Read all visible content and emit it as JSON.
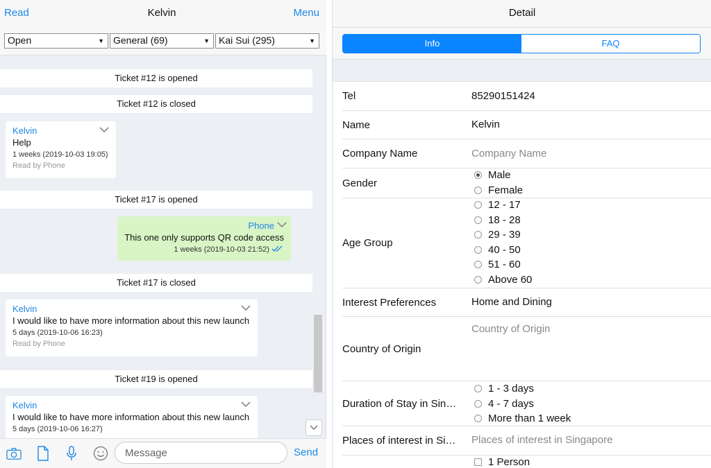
{
  "left_header": {
    "read": "Read",
    "title": "Kelvin",
    "menu": "Menu"
  },
  "filters": [
    {
      "value": "Open"
    },
    {
      "value": "General (69)"
    },
    {
      "value": "Kai Sui (295)"
    }
  ],
  "messages": {
    "sys1": "Ticket #12 is opened",
    "sys2": "Ticket #12 is closed",
    "m1": {
      "who": "Kelvin",
      "text": "Help",
      "time": "1 weeks (2019-10-03 19:05)",
      "readby": "Read by Phone"
    },
    "sys3": "Ticket #17 is opened",
    "m2": {
      "who": "Phone",
      "text": "This one only supports QR code access",
      "time": "1 weeks (2019-10-03 21:52)"
    },
    "sys4": "Ticket #17 is closed",
    "m3": {
      "who": "Kelvin",
      "text": "I would like to have more information about this new launch",
      "time": "5 days (2019-10-06 16:23)",
      "readby": "Read by Phone"
    },
    "sys5": "Ticket #19 is opened",
    "m4": {
      "who": "Kelvin",
      "text": "I would like to have more information about this new launch",
      "time": "5 days (2019-10-06 16:27)"
    }
  },
  "composer": {
    "placeholder": "Message",
    "send": "Send"
  },
  "right_header": {
    "title": "Detail"
  },
  "tabs": {
    "info": "Info",
    "faq": "FAQ"
  },
  "form": {
    "tel": {
      "label": "Tel",
      "value": "85290151424"
    },
    "name": {
      "label": "Name",
      "value": "Kelvin"
    },
    "company": {
      "label": "Company Name",
      "placeholder": "Company Name"
    },
    "gender": {
      "label": "Gender",
      "options": [
        "Male",
        "Female"
      ],
      "selected": "Male"
    },
    "age": {
      "label": "Age Group",
      "options": [
        "12 - 17",
        "18 - 28",
        "29 - 39",
        "40 - 50",
        "51 - 60",
        "Above 60"
      ]
    },
    "interest": {
      "label": "Interest Preferences",
      "value": "Home and Dining"
    },
    "country": {
      "label": "Country of Origin",
      "placeholder": "Country of Origin"
    },
    "duration": {
      "label": "Duration of Stay in Sin…",
      "options": [
        "1 - 3 days",
        "4 - 7 days",
        "More than 1 week"
      ]
    },
    "places": {
      "label": "Places of interest in Si…",
      "placeholder": "Places of interest in Singapore"
    },
    "party": {
      "options": [
        "1 Person"
      ]
    }
  },
  "colors": {
    "accent": "#1e88e5",
    "segment": "#0b84ff",
    "outgoing_bubble": "#d9f5c6"
  }
}
